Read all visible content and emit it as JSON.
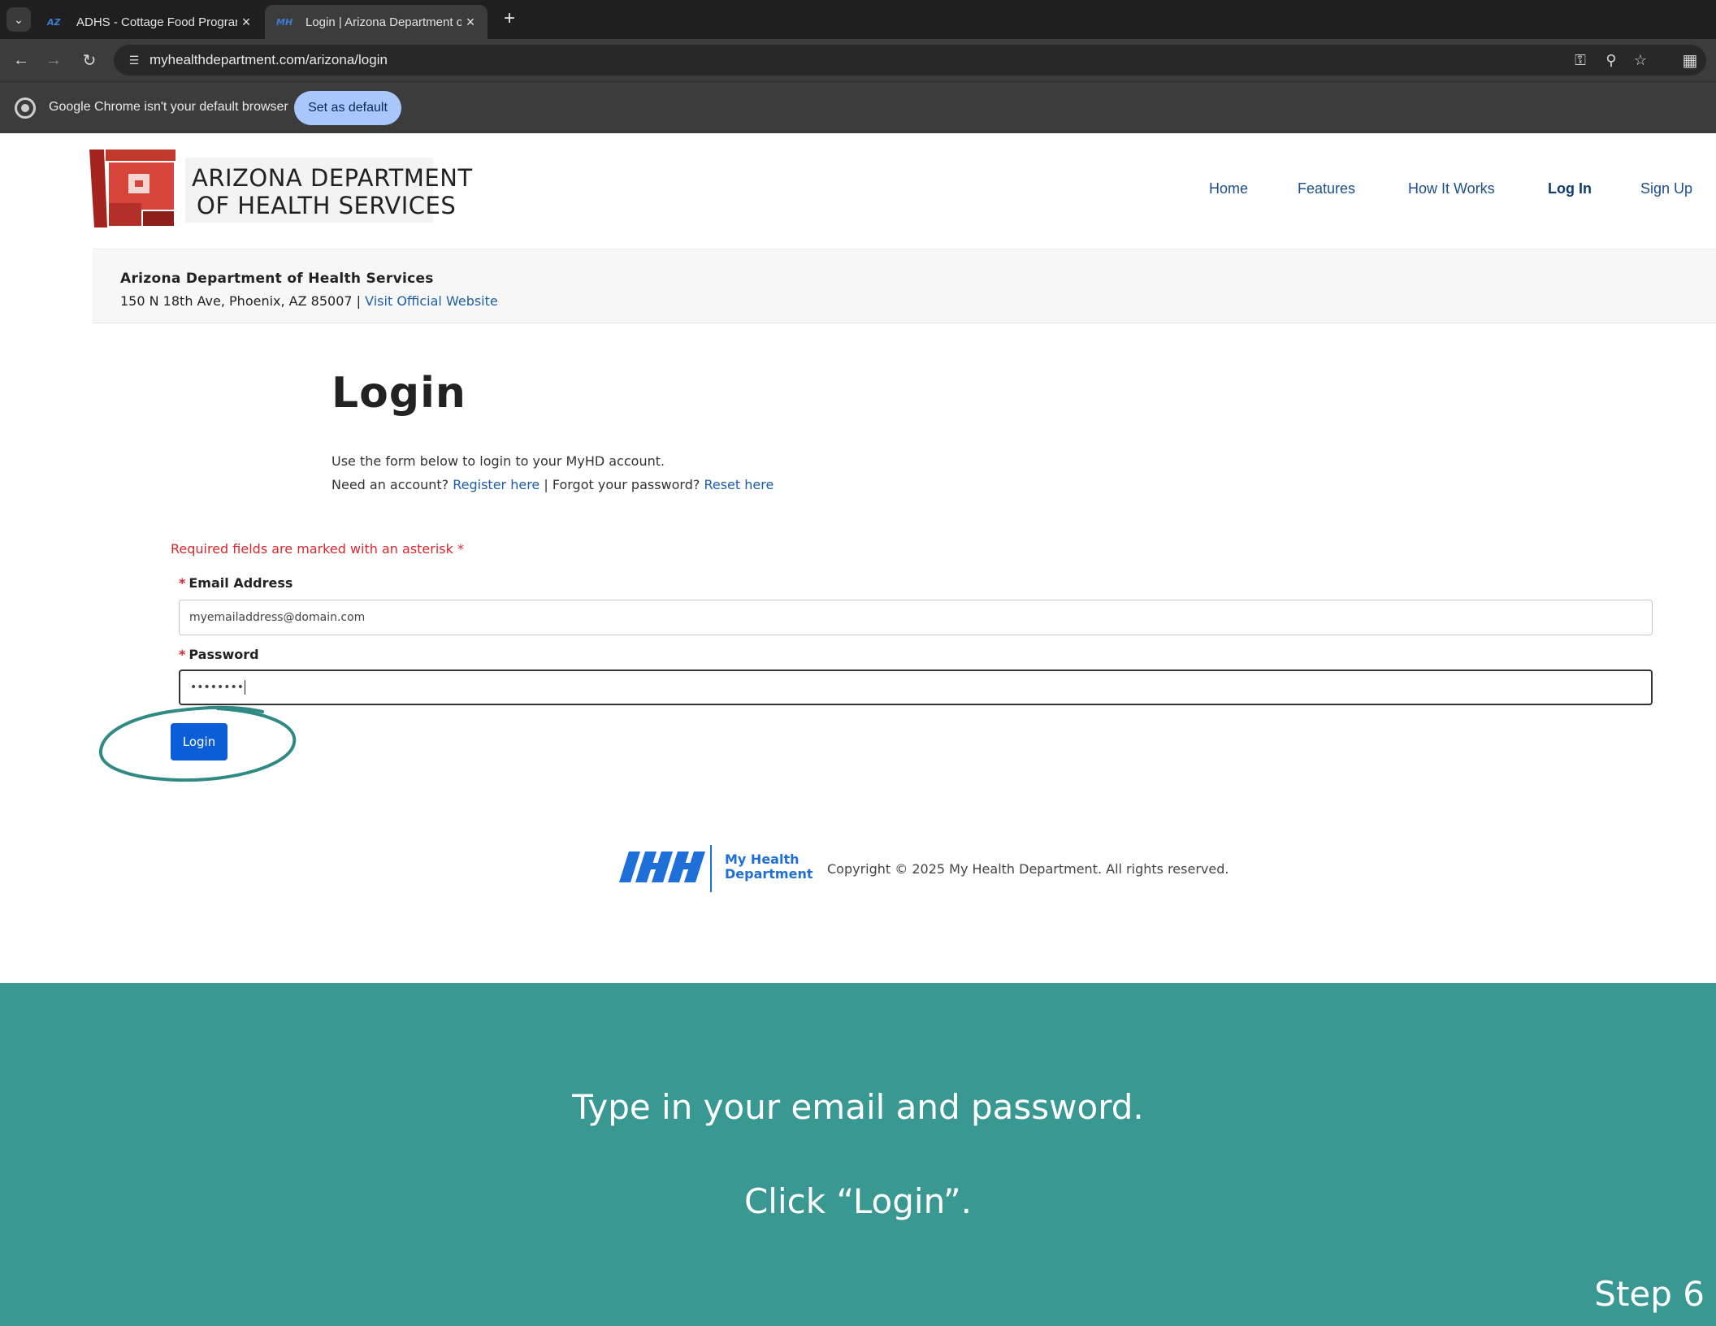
{
  "browser": {
    "tabs": [
      {
        "label": "ADHS - Cottage Food Program",
        "favicon": "AZ",
        "active": false
      },
      {
        "label": "Login | Arizona Department of Health Services",
        "favicon": "MH",
        "active": true
      }
    ],
    "url": "myhealthdepartment.com/arizona/login",
    "infobar": {
      "message": "Google Chrome isn't your default browser",
      "button": "Set as default"
    }
  },
  "site": {
    "logo": {
      "line1": "ARIZONA DEPARTMENT",
      "line2": "OF HEALTH SERVICES"
    },
    "nav": [
      "Home",
      "Features",
      "How It Works",
      "Log In",
      "Sign Up"
    ],
    "nav_active": "Log In",
    "agency": {
      "name": "Arizona Department of Health Services",
      "address": "150 N 18th Ave, Phoenix, AZ 85007",
      "separator": " | ",
      "website_link": "Visit Official Website"
    }
  },
  "login": {
    "heading": "Login",
    "intro": "Use the form below to login to your MyHD account.",
    "need_account": "Need an account? ",
    "register_link": "Register here",
    "forgot_text": " | Forgot your password? ",
    "reset_link": "Reset here",
    "required_note": "Required fields are marked with an asterisk",
    "asterisk": "*",
    "email_label": "Email Address",
    "email_value": "myemailaddress@domain.com",
    "password_label": "Password",
    "password_value": "••••••••",
    "submit": "Login"
  },
  "footer": {
    "brand_line1": "My Health",
    "brand_line2": "Department",
    "copyright": "Copyright © 2025 My Health Department. All rights reserved."
  },
  "instructions": {
    "line1": "Type in your email and password.",
    "line2": "Click “Login”.",
    "step": "Step 6"
  },
  "colors": {
    "accent": "#0b5ed7",
    "panel": "#3a9892",
    "ring": "#2f8a84",
    "required": "#d9272e",
    "logo_red": "#c0392b"
  }
}
